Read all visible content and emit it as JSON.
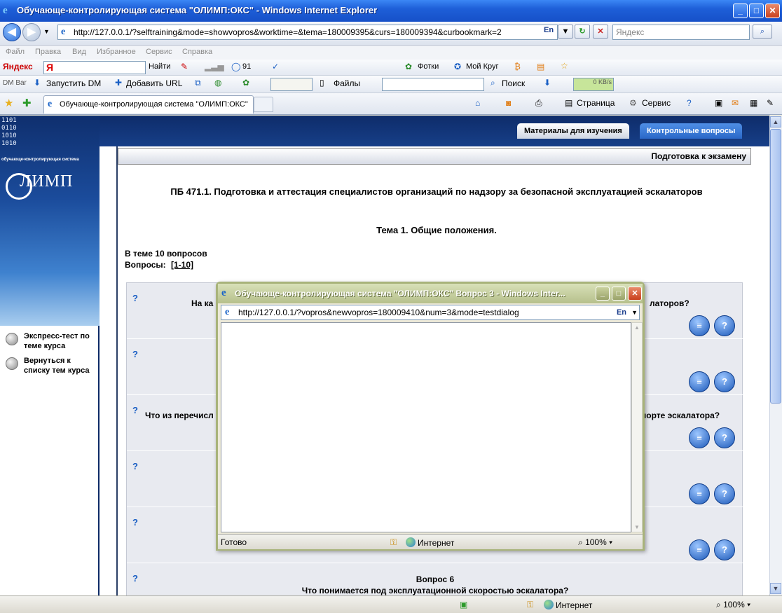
{
  "window": {
    "title": "Обучающе-контролирующая система \"ОЛИМП:ОКС\" - Windows Internet Explorer",
    "min": "_",
    "max": "□",
    "close": "✕"
  },
  "address": {
    "url": "http://127.0.0.1/?selftraining&mode=showvopros&worktime=&tema=180009395&curs=180009394&curbookmark=2",
    "lang": "En",
    "search_placeholder": "Яндекс"
  },
  "menu": [
    "Файл",
    "Правка",
    "Вид",
    "Избранное",
    "Сервис",
    "Справка"
  ],
  "yandex_bar": {
    "brand": "Яндекс",
    "find": "Найти",
    "count": "91",
    "photos": "Фотки",
    "my_circle": "Мой Круг"
  },
  "dm_bar": {
    "label": "DM Bar",
    "start_dm": "Запустить DM",
    "add_url": "Добавить URL",
    "files": "Файлы",
    "search": "Поиск",
    "speed": "0 KB/s"
  },
  "tab": {
    "label": "Обучающе-контролирующая система \"ОЛИМП:ОКС\""
  },
  "command_bar": {
    "page": "Страница",
    "service": "Сервис"
  },
  "left_panel": {
    "binary": "1101\n0110\n1010\n1010",
    "logo_caption": "обучающе-контролирующая система",
    "logo": "ЛИМП",
    "links": [
      "Экспресс-тест по теме курса",
      "Вернуться к списку тем курса"
    ]
  },
  "page_tabs": [
    "Материалы для изучения",
    "Контрольные вопросы"
  ],
  "section": "Подготовка к экзамену",
  "course_title": "ПБ 471.1. Подготовка и аттестация специалистов организаций по надзору за безопасной эксплуатацией эскалаторов",
  "theme_title": "Тема 1. Общие положения.",
  "question_count": "В теме 10 вопросов",
  "questions_label": "Вопросы:",
  "questions_range": "[1-10]",
  "questions": [
    {
      "mark": "?",
      "left": "На ка",
      "right": "латоров?"
    },
    {
      "mark": "?",
      "left": "",
      "right": ""
    },
    {
      "mark": "?",
      "left": "Что из перечисл",
      "right": "порте эскалатора?"
    },
    {
      "mark": "?",
      "left": "",
      "right": ""
    },
    {
      "mark": "?",
      "left": "",
      "right": ""
    },
    {
      "mark": "?",
      "heading": "Вопрос 6",
      "text": "Что понимается под эксплуатационной скоростью эскалатора?"
    }
  ],
  "question_button_icons": [
    "list-icon",
    "help-icon"
  ],
  "status": {
    "zone": "Интернет",
    "zoom": "100%"
  },
  "popup": {
    "title": "Обучающе-контролирующая система \"ОЛИМП:ОКС\" Вопрос 3 - Windows Inter...",
    "url": "http://127.0.0.1/?vopros&newvopros=180009410&num=3&mode=testdialog",
    "lang": "En",
    "status": "Готово",
    "zone": "Интернет",
    "zoom": "100%"
  }
}
